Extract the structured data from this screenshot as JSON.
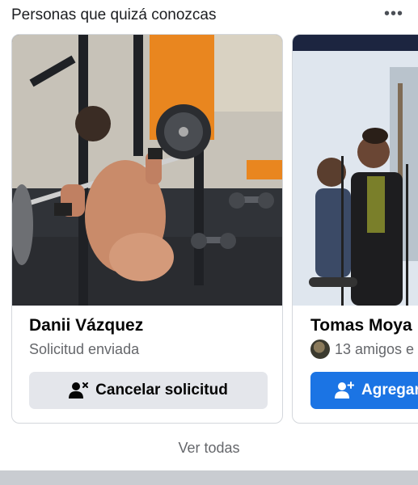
{
  "section": {
    "title": "Personas que quizá conozcas",
    "more_icon": "more-horizontal-icon",
    "see_all": "Ver todas"
  },
  "cards": [
    {
      "name": "Danii Vázquez",
      "status": "Solicitud enviada",
      "button_label": "Cancelar solicitud",
      "button_icon": "person-remove-icon"
    },
    {
      "name": "Tomas Moya",
      "mutual": "13 amigos e",
      "button_label": "Agregar",
      "button_icon": "person-add-icon"
    }
  ],
  "colors": {
    "primary_button": "#1b74e4",
    "secondary_button": "#e4e6eb",
    "muted_text": "#65676b"
  }
}
